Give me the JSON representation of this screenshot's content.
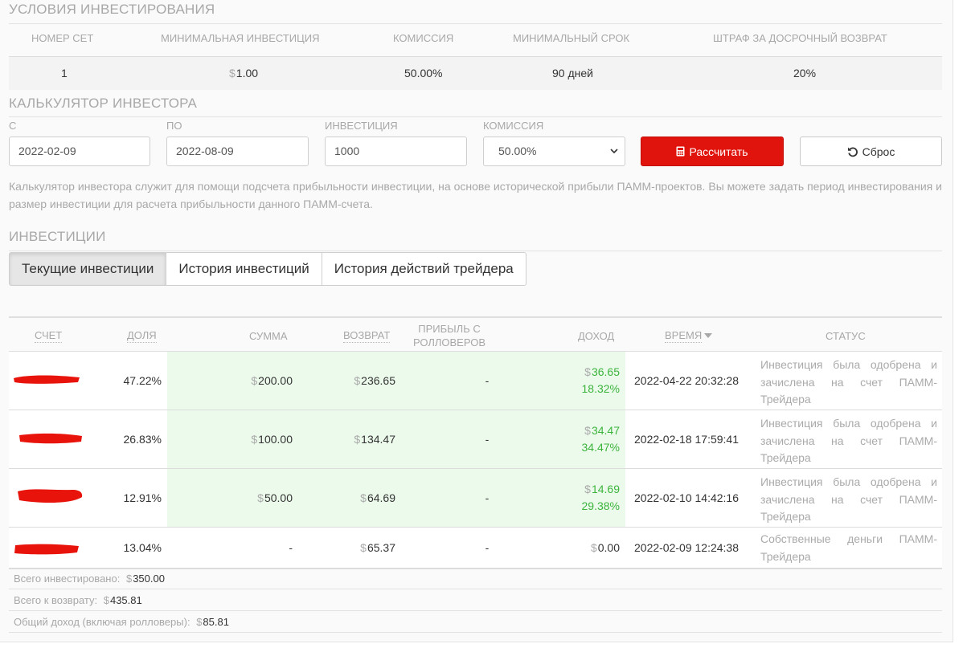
{
  "conditions": {
    "title": "УСЛОВИЯ ИНВЕСТИРОВАНИЯ",
    "headers": [
      "НОМЕР СЕТ",
      "МИНИМАЛЬНАЯ ИНВЕСТИЦИЯ",
      "КОМИССИЯ",
      "МИНИМАЛЬНЫЙ СРОК",
      "ШТРАФ ЗА ДОСРОЧНЫЙ ВОЗВРАТ"
    ],
    "row": {
      "set": "1",
      "min_invest": "1.00",
      "commission": "50.00%",
      "min_term": "90 дней",
      "penalty": "20%"
    }
  },
  "calculator": {
    "title": "КАЛЬКУЛЯТОР ИНВЕСТОРА",
    "from_label": "С",
    "from_value": "2022-02-09",
    "to_label": "ПО",
    "to_value": "2022-08-09",
    "invest_label": "ИНВЕСТИЦИЯ",
    "invest_value": "1000",
    "commission_label": "КОМИССИЯ",
    "commission_value": "50.00%",
    "calc_label": "Рассчитать",
    "reset_label": "Сброс",
    "description": "Калькулятор инвестора служит для помощи подсчета прибыльности инвестиции, на основе исторической прибыли ПАММ-проектов. Вы можете задать период инвестирования и размер инвестиции для расчета прибыльности данного ПАММ-счета."
  },
  "investments": {
    "title": "ИНВЕСТИЦИИ",
    "tabs": [
      "Текущие инвестиции",
      "История инвестиций",
      "История действий трейдера"
    ],
    "columns": {
      "account": "СЧЕТ",
      "share": "ДОЛЯ",
      "sum": "СУММА",
      "return": "ВОЗВРАТ",
      "rollover_1": "ПРИБЫЛЬ С",
      "rollover_2": "РОЛЛОВЕРОВ",
      "income": "ДОХОД",
      "time": "ВРЕМЯ",
      "status": "СТАТУС"
    },
    "currency": "$",
    "rows": [
      {
        "share": "47.22%",
        "sum": "200.00",
        "ret": "236.65",
        "rollover": "-",
        "income": "36.65",
        "income_pct": "18.32%",
        "time": "2022-04-22 20:32:28",
        "status": "Инвестиция была одобрена и зачислена на счет ПАММ-Трейдера"
      },
      {
        "share": "26.83%",
        "sum": "100.00",
        "ret": "134.47",
        "rollover": "-",
        "income": "34.47",
        "income_pct": "34.47%",
        "time": "2022-02-18 17:59:41",
        "status": "Инвестиция была одобрена и зачислена на счет ПАММ-Трейдера"
      },
      {
        "share": "12.91%",
        "sum": "50.00",
        "ret": "64.69",
        "rollover": "-",
        "income": "14.69",
        "income_pct": "29.38%",
        "time": "2022-02-10 14:42:16",
        "status": "Инвестиция была одобрена и зачислена на счет ПАММ-Трейдера"
      },
      {
        "share": "13.04%",
        "sum": "-",
        "ret": "65.37",
        "rollover": "-",
        "income": "0.00",
        "income_pct": "",
        "time": "2022-02-09 12:24:38",
        "status": "Собственные деньги ПАММ-Трейдера"
      }
    ],
    "totals": {
      "invested_label": "Всего инвестировано:",
      "invested": "350.00",
      "to_return_label": "Всего к возврату:",
      "to_return": "435.81",
      "income_label": "Общий доход (включая ролловеры):",
      "income": "85.81"
    }
  },
  "colors": {
    "accent": "#e0140c",
    "positive": "#3cb43c",
    "highlight_bg": "#ecfaec",
    "redaction": "#e8140c"
  }
}
